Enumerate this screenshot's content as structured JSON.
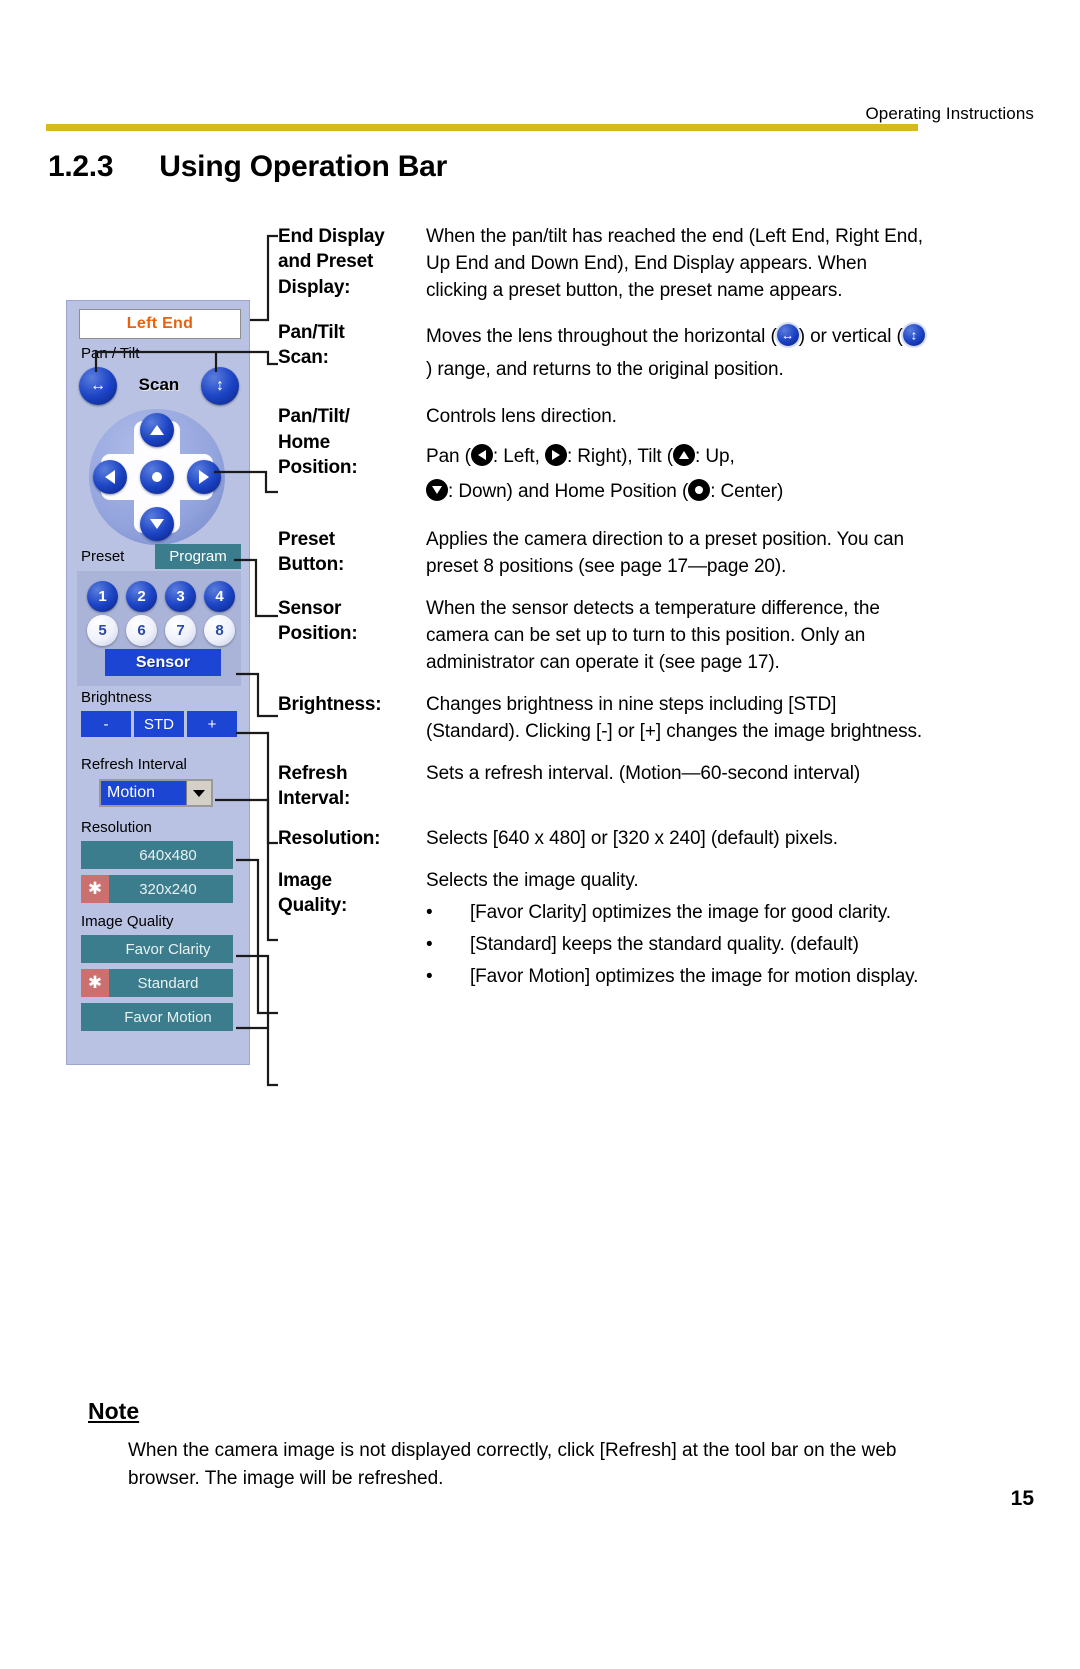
{
  "header": {
    "running_head": "Operating Instructions"
  },
  "title": {
    "number": "1.2.3",
    "text": "Using Operation Bar"
  },
  "operation_bar": {
    "end_display": "Left End",
    "pan_tilt_label": "Pan / Tilt",
    "scan_label": "Scan",
    "preset_label": "Preset",
    "program_label": "Program",
    "preset_buttons": [
      {
        "label": "1",
        "state": "on"
      },
      {
        "label": "2",
        "state": "on"
      },
      {
        "label": "3",
        "state": "on"
      },
      {
        "label": "4",
        "state": "on"
      },
      {
        "label": "5",
        "state": "off"
      },
      {
        "label": "6",
        "state": "off"
      },
      {
        "label": "7",
        "state": "off"
      },
      {
        "label": "8",
        "state": "off"
      }
    ],
    "sensor_label": "Sensor",
    "brightness_label": "Brightness",
    "brightness_buttons": [
      "-",
      "STD",
      "+"
    ],
    "refresh_label": "Refresh Interval",
    "refresh_value": "Motion",
    "resolution_label": "Resolution",
    "resolution_options": [
      {
        "label": "640x480",
        "selected": false
      },
      {
        "label": "320x240",
        "selected": true
      }
    ],
    "image_quality_label": "Image Quality",
    "image_quality_options": [
      {
        "label": "Favor Clarity",
        "selected": false
      },
      {
        "label": "Standard",
        "selected": true
      },
      {
        "label": "Favor Motion",
        "selected": false
      }
    ],
    "colors": {
      "panel": "#b9c2e2",
      "button_blue": "#1b45d2",
      "list_teal": "#3b7d8c",
      "selected_red": "#cb6f6f",
      "end_display_text": "#e8610e",
      "program_tab": "#3b7d8c"
    }
  },
  "descriptions": [
    {
      "term": "End Display and Preset Display:",
      "term_lines": [
        "End Display",
        "and Preset",
        "Display:"
      ],
      "body": "When the pan/tilt has reached the end (Left End, Right End, Up End and Down End), End Display appears. When clicking a preset button, the preset name appears."
    },
    {
      "term": "Pan/Tilt Scan:",
      "term_lines": [
        "Pan/Tilt",
        "Scan:"
      ],
      "body_part1": "Moves the lens throughout the horizontal (",
      "body_part2": ") or vertical (",
      "body_part3": ") range, and returns to the original position."
    },
    {
      "term": "Pan/Tilt/ Home Position:",
      "term_lines": [
        "Pan/Tilt/",
        "Home",
        "Position:"
      ],
      "line1": "Controls lens direction.",
      "pan_prefix": "Pan (",
      "pan_left": ": Left, ",
      "pan_right": ": Right), Tilt (",
      "tilt_up": ": Up,",
      "tilt_down": ": Down) and Home Position (",
      "home_center": ": Center)"
    },
    {
      "term": "Preset Button:",
      "term_lines": [
        "Preset",
        "Button:"
      ],
      "body": "Applies the camera direction to a preset position. You can preset 8 positions (see page 17—page 20)."
    },
    {
      "term": "Sensor Position:",
      "term_lines": [
        "Sensor",
        "Position:"
      ],
      "body": "When the sensor detects a temperature difference, the camera can be set up to turn to this position. Only an administrator can operate it (see page 17)."
    },
    {
      "term": "Brightness:",
      "term_lines": [
        "Brightness:"
      ],
      "body": "Changes brightness in nine steps including [STD] (Standard). Clicking [-] or [+] changes the image brightness."
    },
    {
      "term": "Refresh Interval:",
      "term_lines": [
        "Refresh",
        "Interval:"
      ],
      "body": "Sets a refresh interval. (Motion—60-second interval)"
    },
    {
      "term": "Resolution:",
      "term_lines": [
        "Resolution:"
      ],
      "body": "Selects [640 x 480] or [320 x 240] (default) pixels."
    },
    {
      "term": "Image Quality:",
      "term_lines": [
        "Image",
        "Quality:"
      ],
      "body": "Selects the image quality.",
      "bullets": [
        "[Favor Clarity] optimizes the image for good clarity.",
        "[Standard] keeps the standard quality. (default)",
        "[Favor Motion] optimizes the image for motion display."
      ],
      "bullet_char": "•"
    }
  ],
  "note": {
    "heading": "Note",
    "body": "When the camera image is not displayed correctly, click [Refresh] at the tool bar on the web browser. The image will be refreshed."
  },
  "footer": {
    "page_number": "15"
  }
}
